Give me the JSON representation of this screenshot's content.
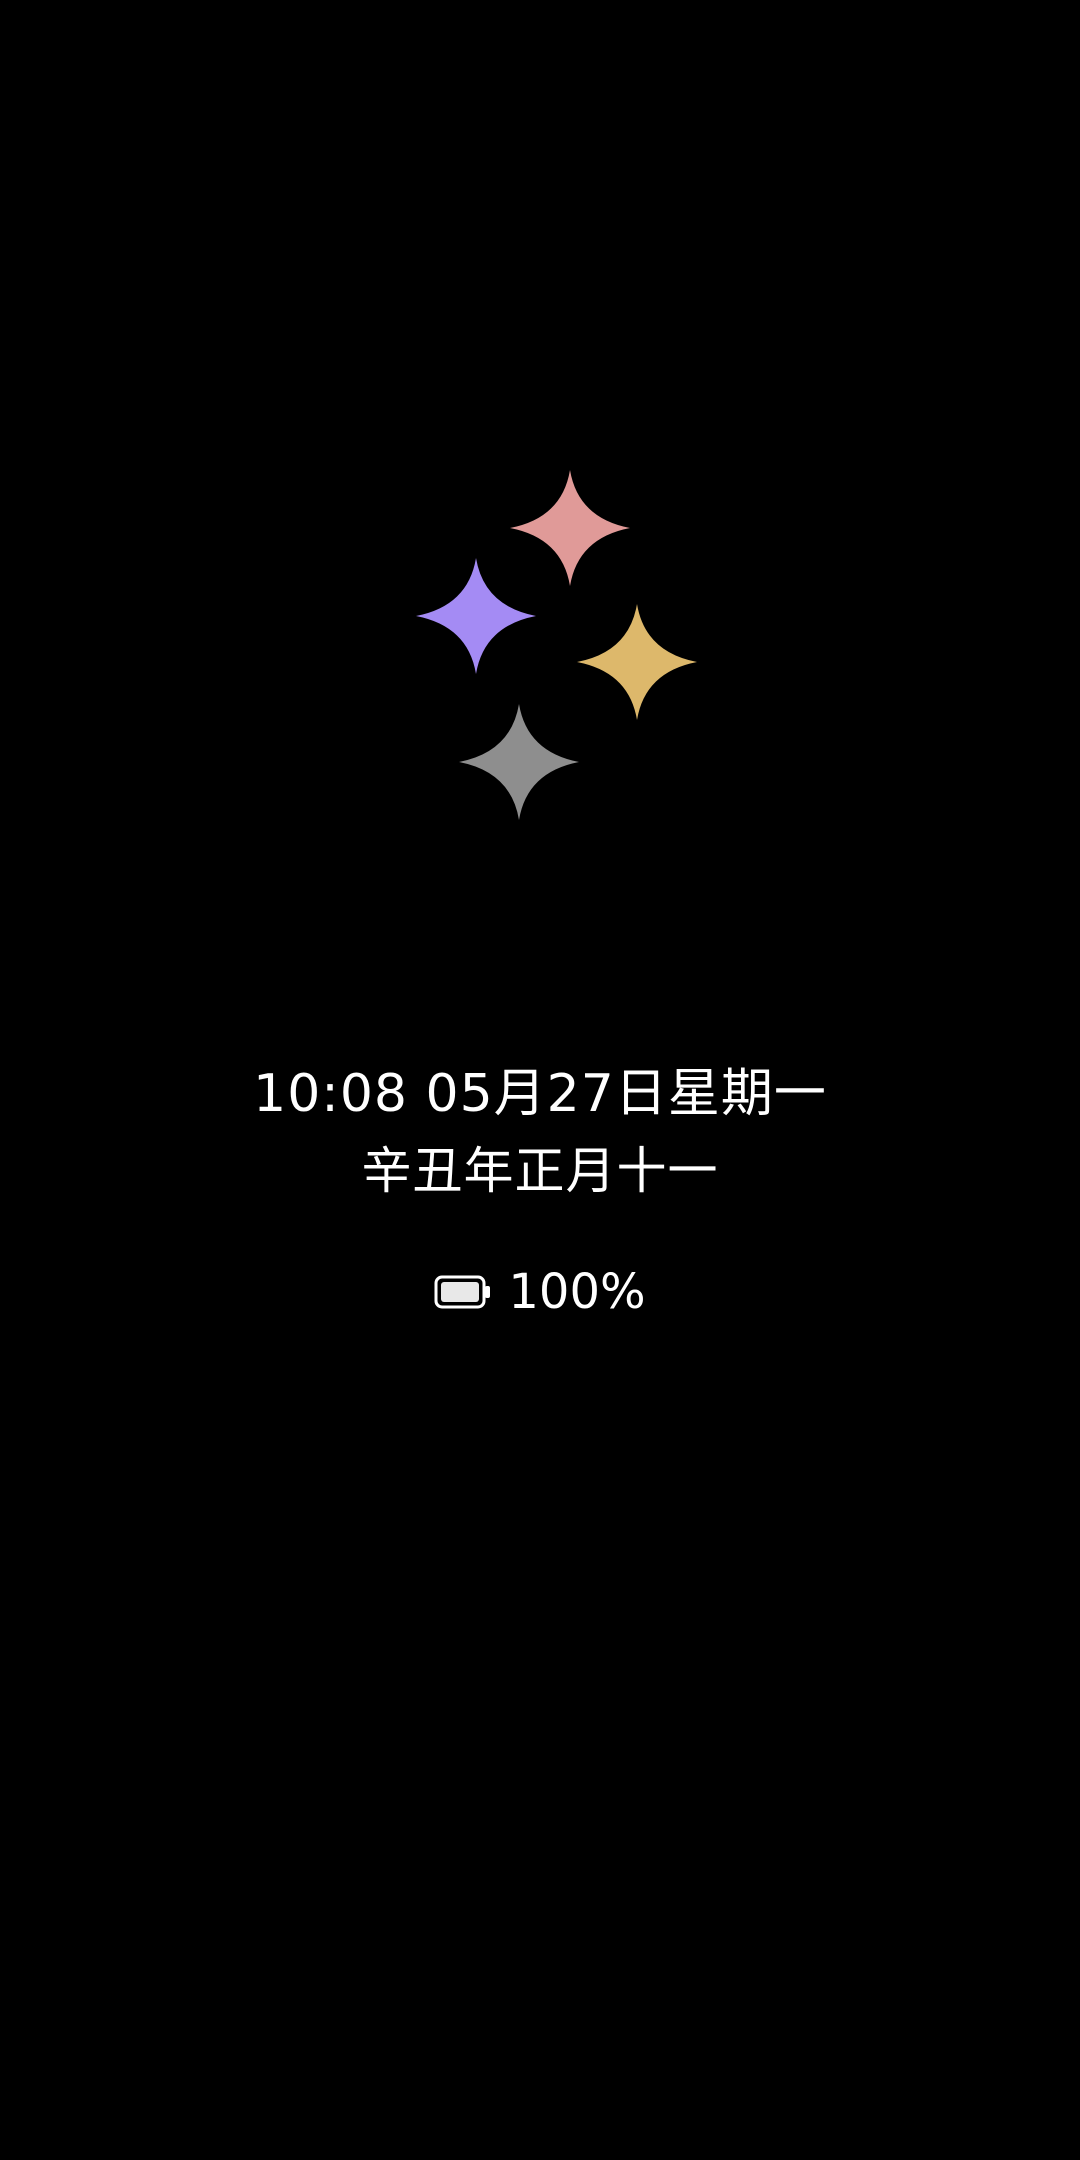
{
  "aod": {
    "time": "10:08",
    "date": "05月27日",
    "weekday": "星期一",
    "lunar_date": "辛丑年正月十一",
    "battery_percent_label": "100%",
    "battery_level": 1.0
  },
  "sparkles": [
    {
      "name": "sparkle-pink-icon",
      "color": "#E09A98"
    },
    {
      "name": "sparkle-purple-icon",
      "color": "#A48BF4"
    },
    {
      "name": "sparkle-gold-icon",
      "color": "#DDB86B"
    },
    {
      "name": "sparkle-gray-icon",
      "color": "#8E8E8E"
    }
  ],
  "colors": {
    "background": "#000000",
    "text": "#FFFFFF"
  }
}
